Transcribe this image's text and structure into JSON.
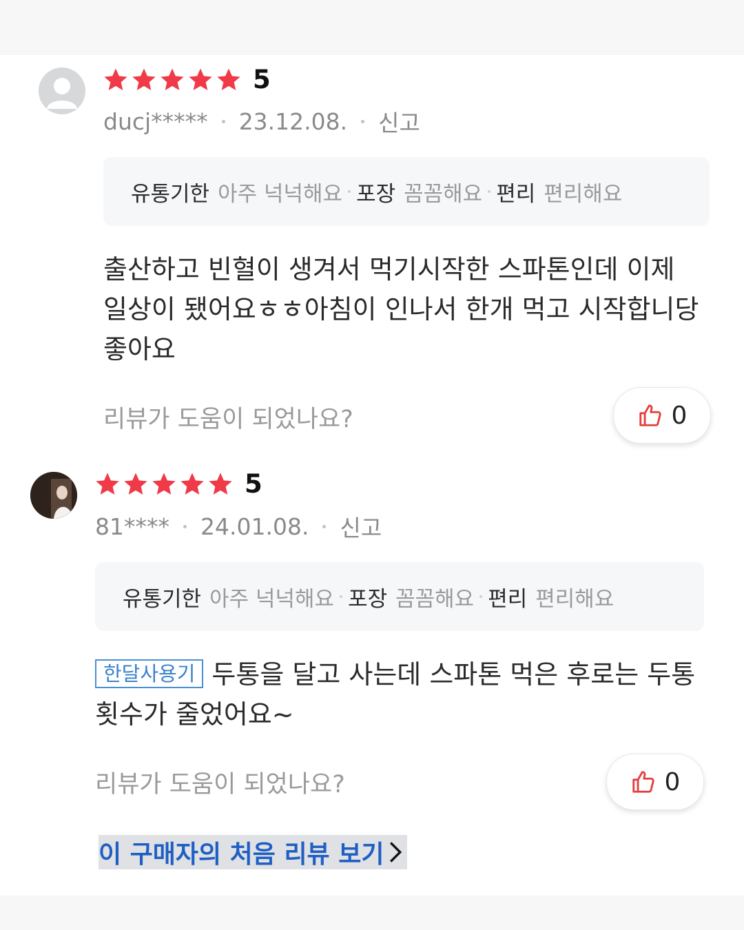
{
  "colors": {
    "star": "#f03a47",
    "thumb": "#e63d3d",
    "link": "#1f5fc4",
    "badge": "#3a82cc"
  },
  "reviews": [
    {
      "rating": "5",
      "user": "ducj*****",
      "date": "23.12.08.",
      "report_label": "신고",
      "tags": [
        {
          "label": "유통기한",
          "value": "아주 넉넉해요"
        },
        {
          "label": "포장",
          "value": "꼼꼼해요"
        },
        {
          "label": "편리",
          "value": "편리해요"
        }
      ],
      "text": "출산하고 빈혈이 생겨서 먹기시작한 스파톤인데 이제 일상이 됐어요ㅎㅎ아침이 인나서 한개 먹고 시작합니당 좋아요",
      "helpful_prompt": "리뷰가 도움이 되었나요?",
      "likes": "0"
    },
    {
      "rating": "5",
      "user": "81****",
      "date": "24.01.08.",
      "report_label": "신고",
      "tags": [
        {
          "label": "유통기한",
          "value": "아주 넉넉해요"
        },
        {
          "label": "포장",
          "value": "꼼꼼해요"
        },
        {
          "label": "편리",
          "value": "편리해요"
        }
      ],
      "badge": "한달사용기",
      "text": "두통을 달고 사는데 스파톤 먹은 후로는 두통 횟수가 줄었어요~",
      "helpful_prompt": "리뷰가 도움이 되었나요?",
      "likes": "0"
    }
  ],
  "first_review_link": "이 구매자의 처음 리뷰 보기"
}
